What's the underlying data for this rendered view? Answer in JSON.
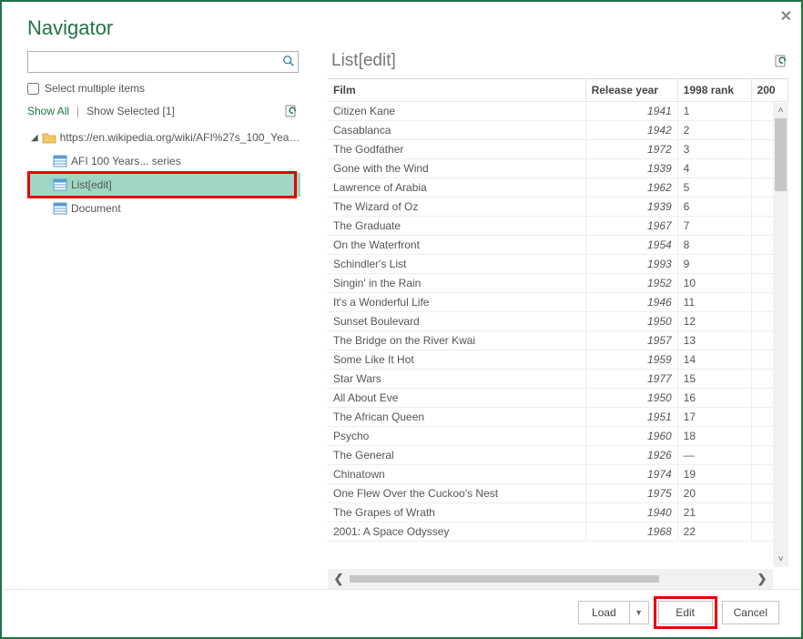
{
  "dialog": {
    "title": "Navigator",
    "close_tooltip": "Close"
  },
  "left": {
    "search_placeholder": "",
    "select_multiple_label": "Select multiple items",
    "show_all": "Show All",
    "show_selected": "Show Selected [1]",
    "tree": {
      "root_label": "https://en.wikipedia.org/wiki/AFI%27s_100_Years...",
      "children": [
        {
          "label": "AFI 100 Years... series",
          "selected": false
        },
        {
          "label": "List[edit]",
          "selected": true
        },
        {
          "label": "Document",
          "selected": false
        }
      ]
    }
  },
  "preview": {
    "title": "List[edit]",
    "columns": [
      "Film",
      "Release year",
      "1998 rank",
      "200"
    ],
    "rows": [
      {
        "film": "Citizen Kane",
        "year": "1941",
        "rank": "1"
      },
      {
        "film": "Casablanca",
        "year": "1942",
        "rank": "2"
      },
      {
        "film": "The Godfather",
        "year": "1972",
        "rank": "3"
      },
      {
        "film": "Gone with the Wind",
        "year": "1939",
        "rank": "4"
      },
      {
        "film": "Lawrence of Arabia",
        "year": "1962",
        "rank": "5"
      },
      {
        "film": "The Wizard of Oz",
        "year": "1939",
        "rank": "6"
      },
      {
        "film": "The Graduate",
        "year": "1967",
        "rank": "7"
      },
      {
        "film": "On the Waterfront",
        "year": "1954",
        "rank": "8"
      },
      {
        "film": "Schindler's List",
        "year": "1993",
        "rank": "9"
      },
      {
        "film": "Singin' in the Rain",
        "year": "1952",
        "rank": "10"
      },
      {
        "film": "It's a Wonderful Life",
        "year": "1946",
        "rank": "11"
      },
      {
        "film": "Sunset Boulevard",
        "year": "1950",
        "rank": "12"
      },
      {
        "film": "The Bridge on the River Kwai",
        "year": "1957",
        "rank": "13"
      },
      {
        "film": "Some Like It Hot",
        "year": "1959",
        "rank": "14"
      },
      {
        "film": "Star Wars",
        "year": "1977",
        "rank": "15"
      },
      {
        "film": "All About Eve",
        "year": "1950",
        "rank": "16"
      },
      {
        "film": "The African Queen",
        "year": "1951",
        "rank": "17"
      },
      {
        "film": "Psycho",
        "year": "1960",
        "rank": "18"
      },
      {
        "film": "The General",
        "year": "1926",
        "rank": "—"
      },
      {
        "film": "Chinatown",
        "year": "1974",
        "rank": "19"
      },
      {
        "film": "One Flew Over the Cuckoo's Nest",
        "year": "1975",
        "rank": "20"
      },
      {
        "film": "The Grapes of Wrath",
        "year": "1940",
        "rank": "21"
      },
      {
        "film": "2001: A Space Odyssey",
        "year": "1968",
        "rank": "22"
      }
    ]
  },
  "footer": {
    "load": "Load",
    "edit": "Edit",
    "cancel": "Cancel"
  }
}
